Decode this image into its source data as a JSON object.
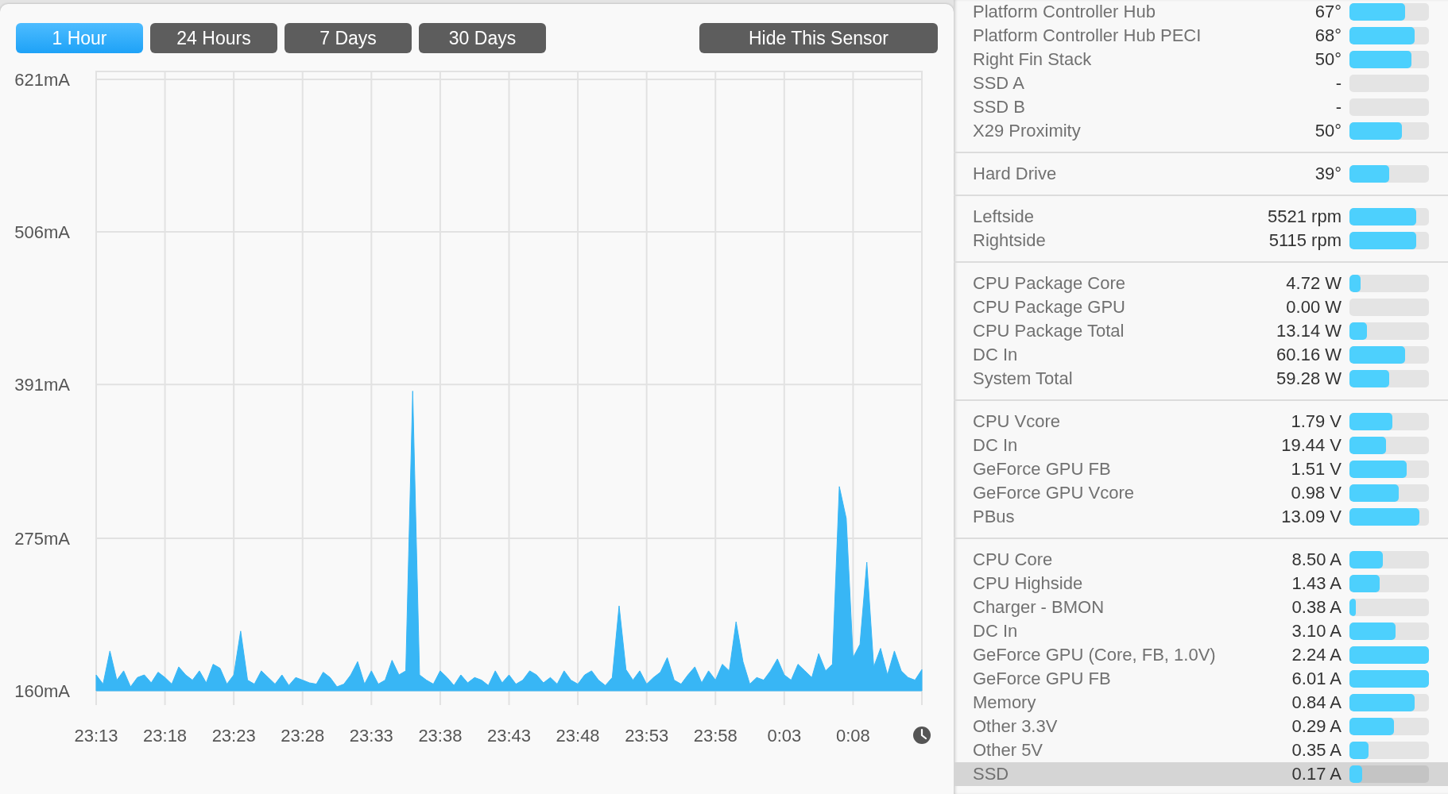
{
  "range_buttons": [
    {
      "label": "1 Hour",
      "selected": true
    },
    {
      "label": "24 Hours",
      "selected": false
    },
    {
      "label": "7 Days",
      "selected": false
    },
    {
      "label": "30 Days",
      "selected": false
    }
  ],
  "hide_button": "Hide This Sensor",
  "chart": {
    "chart_data": {
      "type": "area",
      "color": "#38b6f5",
      "values": [
        172,
        165,
        190,
        168,
        175,
        163,
        170,
        172,
        166,
        174,
        170,
        165,
        178,
        172,
        168,
        175,
        166,
        180,
        177,
        165,
        172,
        205,
        168,
        165,
        175,
        170,
        165,
        172,
        164,
        170,
        168,
        166,
        165,
        174,
        170,
        163,
        165,
        172,
        182,
        165,
        175,
        165,
        168,
        183,
        172,
        175,
        386,
        172,
        168,
        165,
        175,
        170,
        164,
        172,
        166,
        170,
        168,
        164,
        175,
        166,
        172,
        165,
        168,
        175,
        172,
        166,
        170,
        165,
        175,
        168,
        165,
        172,
        175,
        168,
        164,
        170,
        224,
        176,
        168,
        175,
        165,
        170,
        174,
        185,
        168,
        165,
        172,
        178,
        166,
        175,
        168,
        180,
        175,
        212,
        182,
        165,
        170,
        168,
        175,
        184,
        172,
        168,
        180,
        175,
        170,
        188,
        175,
        180,
        314,
        290,
        185,
        195,
        257,
        178,
        192,
        172,
        190,
        175,
        170,
        168,
        176
      ],
      "categories": [
        "23:13",
        null,
        null,
        null,
        null,
        null,
        null,
        null,
        null,
        null,
        "23:18",
        null,
        null,
        null,
        null,
        null,
        null,
        null,
        null,
        null,
        "23:23",
        null,
        null,
        null,
        null,
        null,
        null,
        null,
        null,
        null,
        "23:28",
        null,
        null,
        null,
        null,
        null,
        null,
        null,
        null,
        null,
        "23:33",
        null,
        null,
        null,
        null,
        null,
        null,
        null,
        null,
        null,
        "23:38",
        null,
        null,
        null,
        null,
        null,
        null,
        null,
        null,
        null,
        "23:43",
        null,
        null,
        null,
        null,
        null,
        null,
        null,
        null,
        null,
        "23:48",
        null,
        null,
        null,
        null,
        null,
        null,
        null,
        null,
        null,
        "23:53",
        null,
        null,
        null,
        null,
        null,
        null,
        null,
        null,
        null,
        "23:58",
        null,
        null,
        null,
        null,
        null,
        null,
        null,
        null,
        null,
        "0:03",
        null,
        null,
        null,
        null,
        null,
        null,
        null,
        null,
        null,
        "0:08",
        null,
        null,
        null,
        null,
        null,
        null,
        null,
        null,
        null,
        null
      ],
      "ylim": [
        160,
        621
      ],
      "grid": true,
      "yticks": [
        {
          "value": 621,
          "label": "621mA"
        },
        {
          "value": 506,
          "label": "506mA"
        },
        {
          "value": 391,
          "label": "391mA"
        },
        {
          "value": 275,
          "label": "275mA"
        },
        {
          "value": 160,
          "label": "160mA"
        }
      ]
    }
  },
  "sensor_groups": [
    {
      "rows": [
        {
          "name": "Platform Controller Hub",
          "value": "67°",
          "level": 0.7,
          "selected": false
        },
        {
          "name": "Platform Controller Hub PECI",
          "value": "68°",
          "level": 0.82,
          "selected": false
        },
        {
          "name": "Right Fin Stack",
          "value": "50°",
          "level": 0.78,
          "selected": false
        },
        {
          "name": "SSD A",
          "value": "-",
          "level": 0,
          "selected": false
        },
        {
          "name": "SSD B",
          "value": "-",
          "level": 0,
          "selected": false
        },
        {
          "name": "X29 Proximity",
          "value": "50°",
          "level": 0.66,
          "selected": false
        }
      ]
    },
    {
      "rows": [
        {
          "name": "Hard Drive",
          "value": "39°",
          "level": 0.5,
          "selected": false
        }
      ]
    },
    {
      "rows": [
        {
          "name": "Leftside",
          "value": "5521 rpm",
          "level": 0.84,
          "selected": false
        },
        {
          "name": "Rightside",
          "value": "5115 rpm",
          "level": 0.84,
          "selected": false
        }
      ]
    },
    {
      "rows": [
        {
          "name": "CPU Package Core",
          "value": "4.72 W",
          "level": 0.14,
          "selected": false
        },
        {
          "name": "CPU Package GPU",
          "value": "0.00 W",
          "level": 0,
          "selected": false
        },
        {
          "name": "CPU Package Total",
          "value": "13.14 W",
          "level": 0.22,
          "selected": false
        },
        {
          "name": "DC In",
          "value": "60.16 W",
          "level": 0.7,
          "selected": false
        },
        {
          "name": "System Total",
          "value": "59.28 W",
          "level": 0.5,
          "selected": false
        }
      ]
    },
    {
      "rows": [
        {
          "name": "CPU Vcore",
          "value": "1.79 V",
          "level": 0.54,
          "selected": false
        },
        {
          "name": "DC In",
          "value": "19.44 V",
          "level": 0.46,
          "selected": false
        },
        {
          "name": "GeForce GPU FB",
          "value": "1.51 V",
          "level": 0.72,
          "selected": false
        },
        {
          "name": "GeForce GPU Vcore",
          "value": "0.98 V",
          "level": 0.62,
          "selected": false
        },
        {
          "name": "PBus",
          "value": "13.09 V",
          "level": 0.88,
          "selected": false
        }
      ]
    },
    {
      "rows": [
        {
          "name": "CPU Core",
          "value": "8.50 A",
          "level": 0.42,
          "selected": false
        },
        {
          "name": "CPU Highside",
          "value": "1.43 A",
          "level": 0.38,
          "selected": false
        },
        {
          "name": "Charger - BMON",
          "value": "0.38 A",
          "level": 0.08,
          "selected": false
        },
        {
          "name": "DC In",
          "value": "3.10 A",
          "level": 0.58,
          "selected": false
        },
        {
          "name": "GeForce GPU (Core, FB, 1.0V)",
          "value": "2.24 A",
          "level": 1,
          "selected": false
        },
        {
          "name": "GeForce GPU FB",
          "value": "6.01 A",
          "level": 1,
          "selected": false
        },
        {
          "name": "Memory",
          "value": "0.84 A",
          "level": 0.82,
          "selected": false
        },
        {
          "name": "Other 3.3V",
          "value": "0.29 A",
          "level": 0.56,
          "selected": false
        },
        {
          "name": "Other 5V",
          "value": "0.35 A",
          "level": 0.24,
          "selected": false
        },
        {
          "name": "SSD",
          "value": "0.17 A",
          "level": 0.16,
          "selected": true
        }
      ]
    }
  ]
}
